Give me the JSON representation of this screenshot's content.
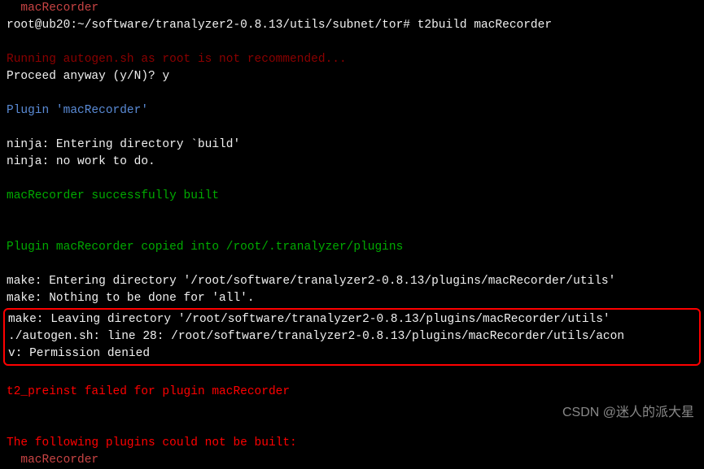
{
  "terminal": {
    "topFragment": "macRecorder",
    "promptUser": "root@ub20",
    "promptPath": ":~/software/tranalyzer2-0.8.13/utils/subnet/tor# ",
    "command": "t2build macRecorder",
    "autogenWarn": "Running autogen.sh as root is not recommended...",
    "proceedPrompt": "Proceed anyway (y/N)? ",
    "proceedAnswer": "y",
    "pluginHeader": "Plugin 'macRecorder'",
    "ninjaEnter": "ninja: Entering directory `build'",
    "ninjaNoWork": "ninja: no work to do.",
    "builtSuccess": "macRecorder successfully built",
    "copiedMsg": "Plugin macRecorder copied into /root/.tranalyzer/plugins",
    "makeEnter": "make: Entering directory '/root/software/tranalyzer2-0.8.13/plugins/macRecorder/utils'",
    "makeNothing": "make: Nothing to be done for 'all'.",
    "makeLeave": "make: Leaving directory '/root/software/tranalyzer2-0.8.13/plugins/macRecorder/utils'",
    "autogenErr": "./autogen.sh: line 28: /root/software/tranalyzer2-0.8.13/plugins/macRecorder/utils/acon",
    "permDenied": "v: Permission denied",
    "preinstFail": "t2_preinst failed for plugin macRecorder",
    "couldNotBuild": "The following plugins could not be built:",
    "failedPlugin": "macRecorder"
  },
  "watermark": "CSDN @迷人的派大星"
}
